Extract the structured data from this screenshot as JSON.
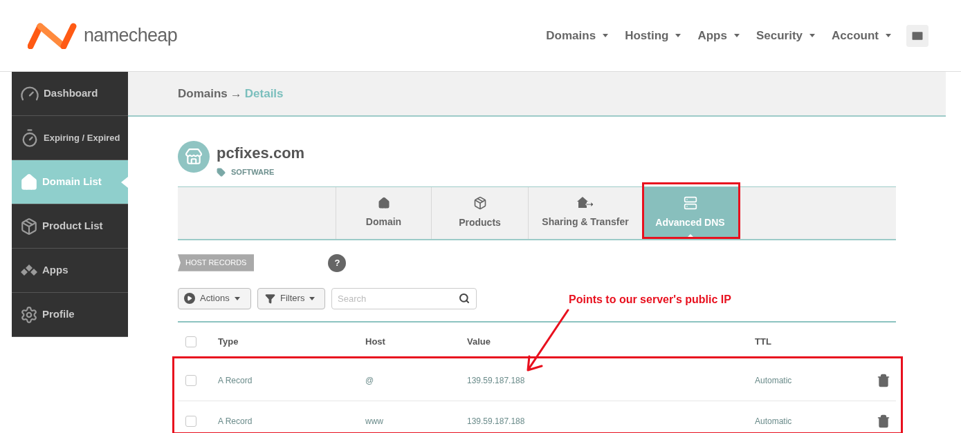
{
  "header": {
    "logo_text": "namecheap",
    "nav": [
      {
        "label": "Domains"
      },
      {
        "label": "Hosting"
      },
      {
        "label": "Apps"
      },
      {
        "label": "Security"
      },
      {
        "label": "Account"
      }
    ]
  },
  "sidebar": {
    "items": [
      {
        "label": "Dashboard",
        "kind": "gauge",
        "selected": false
      },
      {
        "label": "Expiring / Expired",
        "kind": "timer",
        "selected": false
      },
      {
        "label": "Domain List",
        "kind": "house",
        "selected": true
      },
      {
        "label": "Product List",
        "kind": "box",
        "selected": false
      },
      {
        "label": "Apps",
        "kind": "apps",
        "selected": false
      },
      {
        "label": "Profile",
        "kind": "gear",
        "selected": false
      }
    ]
  },
  "breadcrumb": {
    "parent": "Domains",
    "separator": "→",
    "current": "Details"
  },
  "domain": {
    "name": "pcfixes.com",
    "category": "SOFTWARE"
  },
  "tabs": [
    {
      "label": "Domain",
      "kind": "house",
      "selected": false
    },
    {
      "label": "Products",
      "kind": "box",
      "selected": false
    },
    {
      "label": "Sharing & Transfer",
      "kind": "share",
      "selected": false
    },
    {
      "label": "Advanced DNS",
      "kind": "server",
      "selected": true
    }
  ],
  "section_label": "HOST RECORDS",
  "help_button": "?",
  "toolbar": {
    "actions": "Actions",
    "filters": "Filters",
    "search_placeholder": "Search"
  },
  "table": {
    "select_all_checked": false,
    "columns": [
      "Type",
      "Host",
      "Value",
      "TTL"
    ],
    "rows": [
      {
        "checked": false,
        "type": "A Record",
        "host": "@",
        "value": "139.59.187.188",
        "ttl": "Automatic"
      },
      {
        "checked": false,
        "type": "A Record",
        "host": "www",
        "value": "139.59.187.188",
        "ttl": "Automatic"
      }
    ]
  },
  "annotation": {
    "text": "Points to our server's public IP"
  }
}
